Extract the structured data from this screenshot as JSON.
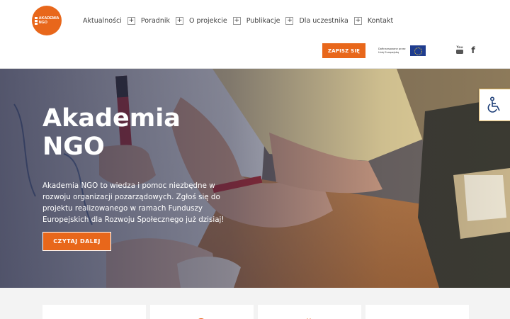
{
  "header": {
    "logo_text_line1": "AKADEMIA",
    "logo_text_line2": "NGO",
    "nav": [
      {
        "label": "Aktualności",
        "has_submenu": true
      },
      {
        "label": "Poradnik",
        "has_submenu": true
      },
      {
        "label": "O projekcie",
        "has_submenu": true
      },
      {
        "label": "Publikacje",
        "has_submenu": true
      },
      {
        "label": "Dla uczestnika",
        "has_submenu": true
      },
      {
        "label": "Kontakt",
        "has_submenu": false
      }
    ],
    "expand_symbol": "+",
    "signup_label": "ZAPISZ SIĘ",
    "eu_text_line1": "Dofinansowane przez",
    "eu_text_line2": "Unię Europejską",
    "youtube_label": "You",
    "facebook_glyph": "f"
  },
  "hero": {
    "title_line1": "Akademia",
    "title_line2": "NGO",
    "description": "Akademia NGO to wiedza i pomoc niezbędne w rozwoju organizacji pozarządowych. Zgłoś się do projektu realizowanego w ramach Funduszy Europejskich dla Rozwoju Społecznego już dzisiaj!",
    "button_label": "CZYTAJ DALEJ"
  },
  "colors": {
    "accent": "#e8671b",
    "eu_blue": "#1f3d8f",
    "text_dark": "#444444"
  },
  "icons": [
    "accessibility-icon",
    "youtube-icon",
    "facebook-icon",
    "eu-flag-icon"
  ]
}
